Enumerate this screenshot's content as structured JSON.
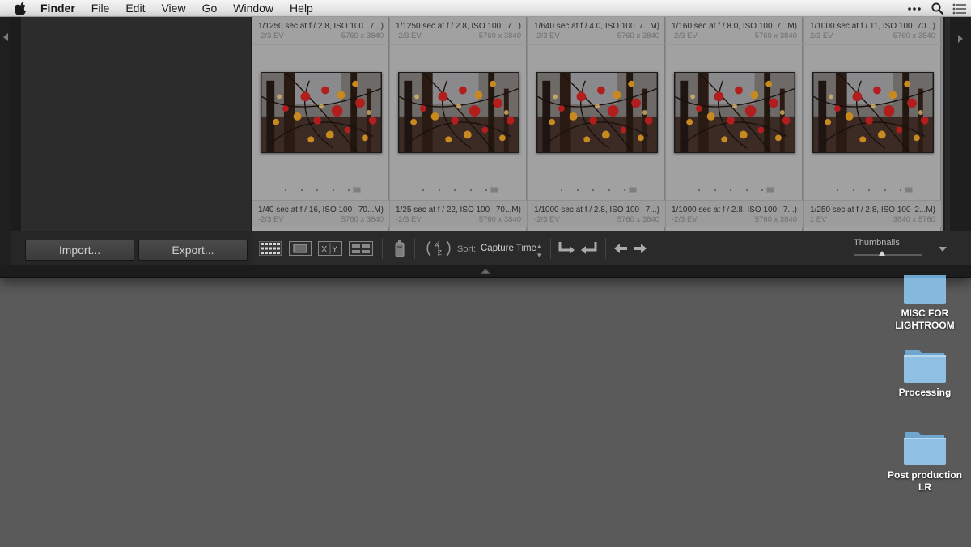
{
  "menubar": {
    "app_name": "Finder",
    "items": [
      "File",
      "Edit",
      "View",
      "Go",
      "Window",
      "Help"
    ]
  },
  "lightroom": {
    "buttons": {
      "import": "Import...",
      "export": "Export..."
    },
    "cells": [
      {
        "top_line1": "1/1250 sec at f / 2.8, ISO 100",
        "top_suffix": "7...)",
        "top_ev": "-2/3 EV",
        "top_dims": "5760 x 3840",
        "bot_line1": "1/40 sec at f / 16, ISO 100",
        "bot_suffix": "70...M)",
        "bot_ev": "-2/3 EV",
        "bot_dims": "5760 x 3840"
      },
      {
        "top_line1": "1/1250 sec at f / 2.8, ISO 100",
        "top_suffix": "7...)",
        "top_ev": "-2/3 EV",
        "top_dims": "5760 x 3840",
        "bot_line1": "1/25 sec at f / 22, ISO 100",
        "bot_suffix": "70...M)",
        "bot_ev": "-2/3 EV",
        "bot_dims": "5760 x 3840"
      },
      {
        "top_line1": "1/640 sec at f / 4.0, ISO 100",
        "top_suffix": "7...M)",
        "top_ev": "-2/3 EV",
        "top_dims": "5760 x 3840",
        "bot_line1": "1/1000 sec at f / 2.8, ISO 100",
        "bot_suffix": "7...)",
        "bot_ev": "-2/3 EV",
        "bot_dims": "5760 x 3840"
      },
      {
        "top_line1": "1/160 sec at f / 8.0, ISO 100",
        "top_suffix": "7...M)",
        "top_ev": "-2/3 EV",
        "top_dims": "5760 x 3840",
        "bot_line1": "1/1000 sec at f / 2.8, ISO 100",
        "bot_suffix": "7...)",
        "bot_ev": "-2/3 EV",
        "bot_dims": "5760 x 3840"
      },
      {
        "top_line1": "1/1000 sec at f / 11, ISO 100",
        "top_suffix": "70...)",
        "top_ev": "2/3 EV",
        "top_dims": "5760 x 3840",
        "bot_line1": "1/250 sec at f / 2.8, ISO 100",
        "bot_suffix": "2...M)",
        "bot_ev": "1 EV",
        "bot_dims": "3840 x 5760"
      }
    ],
    "toolbar": {
      "sort_label": "Sort:",
      "sort_value": "Capture Time",
      "thumbnails_label": "Thumbnails",
      "thumbnails_level": 0.4
    }
  },
  "desktop": {
    "folders": [
      {
        "label": "MISC FOR LIGHTROOM"
      },
      {
        "label": "Processing"
      },
      {
        "label": "Post production LR"
      }
    ],
    "folder_color": "#8fc0e3"
  }
}
